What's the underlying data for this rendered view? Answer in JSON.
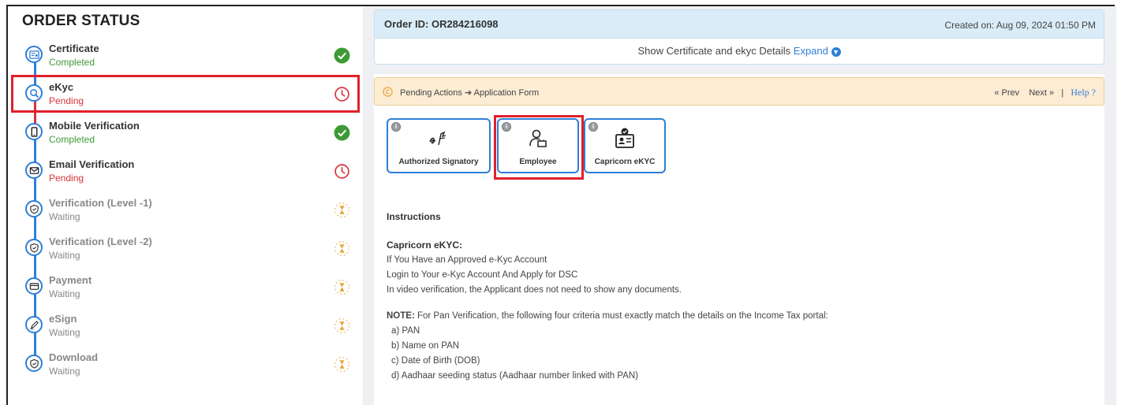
{
  "left": {
    "title": "ORDER STATUS",
    "steps": [
      {
        "title": "Certificate",
        "status": "Completed",
        "state": "completed",
        "icon": "certificate-icon"
      },
      {
        "title": "eKyc",
        "status": "Pending",
        "state": "pending",
        "icon": "ekyc-search-icon"
      },
      {
        "title": "Mobile Verification",
        "status": "Completed",
        "state": "completed",
        "icon": "mobile-icon"
      },
      {
        "title": "Email Verification",
        "status": "Pending",
        "state": "pending",
        "icon": "email-icon"
      },
      {
        "title": "Verification (Level -1)",
        "status": "Waiting",
        "state": "waiting",
        "icon": "shield-icon"
      },
      {
        "title": "Verification (Level -2)",
        "status": "Waiting",
        "state": "waiting",
        "icon": "shield-icon"
      },
      {
        "title": "Payment",
        "status": "Waiting",
        "state": "waiting",
        "icon": "card-icon"
      },
      {
        "title": "eSign",
        "status": "Waiting",
        "state": "waiting",
        "icon": "pen-icon"
      },
      {
        "title": "Download",
        "status": "Waiting",
        "state": "waiting",
        "icon": "shield-icon"
      }
    ]
  },
  "order": {
    "id_label": "Order ID: OR284216098",
    "created": "Created on: Aug 09, 2024 01:50 PM",
    "show_text": "Show Certificate and ekyc Details",
    "expand_label": "Expand"
  },
  "pending_bar": {
    "text": "Pending Actions ➔ Application Form",
    "prev": "« Prev",
    "next": "Next »",
    "separator": "|",
    "help": "Help ?"
  },
  "cards": [
    {
      "label": "Authorized Signatory",
      "icon": "signature-icon"
    },
    {
      "label": "Employee",
      "icon": "employee-icon"
    },
    {
      "label": "Capricorn eKYC",
      "icon": "id-card-icon"
    }
  ],
  "instructions": {
    "heading": "Instructions",
    "sub_heading": "Capricorn eKYC:",
    "lines": [
      "If You Have an Approved e-Kyc Account",
      "Login to Your e-Kyc Account And Apply for DSC",
      "In video verification, the Applicant does not need to show any documents."
    ],
    "note_label": "NOTE:",
    "note_text": " For Pan Verification, the following four criteria must exactly match the details on the Income Tax portal:",
    "criteria": [
      "a) PAN",
      "b) Name on PAN",
      "c) Date of Birth (DOB)",
      "d) Aadhaar seeding status (Aadhaar number linked with PAN)"
    ]
  },
  "colors": {
    "accent": "#2d7fd6",
    "completed": "#3d9b35",
    "pending": "#d8333b",
    "waiting": "#e8a33a",
    "highlight": "#e0202b"
  }
}
